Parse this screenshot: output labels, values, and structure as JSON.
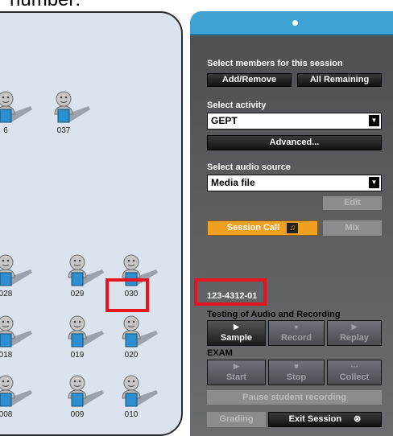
{
  "caption": "number:",
  "students": [
    {
      "num": "6"
    },
    {
      "num": "037"
    },
    {
      "num": "028"
    },
    {
      "num": "029"
    },
    {
      "num": "030"
    },
    {
      "num": "018"
    },
    {
      "num": "019"
    },
    {
      "num": "020"
    },
    {
      "num": "008"
    },
    {
      "num": "009"
    },
    {
      "num": "010"
    }
  ],
  "panel": {
    "members_label": "Select members for this session",
    "add_remove": "Add/Remove",
    "all_remaining": "All Remaining",
    "activity_label": "Select activity",
    "activity_value": "GEPT",
    "advanced": "Advanced...",
    "audio_label": "Select audio source",
    "audio_value": "Media file",
    "edit": "Edit",
    "session_call": "Session Call",
    "mix": "Mix",
    "session_id": "123-4312-01",
    "testing_label": "Testing of Audio and Recording",
    "sample": "Sample",
    "record": "Record",
    "replay": "Replay",
    "exam_label": "EXAM",
    "start": "Start",
    "stop": "Stop",
    "collect": "Collect",
    "pause": "Pause student recording",
    "grading": "Grading",
    "exit": "Exit Session"
  },
  "colors": {
    "accent": "#3ea3d3",
    "highlight": "#e8141c",
    "session_call": "#f0a020"
  }
}
